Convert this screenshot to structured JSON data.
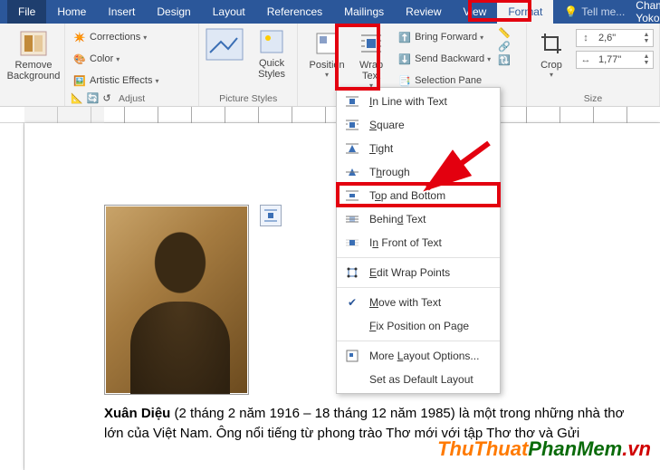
{
  "menubar": {
    "file": "File",
    "tabs": [
      "Home",
      "Insert",
      "Design",
      "Layout",
      "References",
      "Mailings",
      "Review",
      "View",
      "Format"
    ],
    "active": "Format",
    "tellme": "Tell me...",
    "user": "Cham Yoko"
  },
  "ribbon": {
    "adjust": {
      "remove_bg": "Remove\nBackground",
      "corrections": "Corrections",
      "color": "Color",
      "artistic": "Artistic Effects",
      "label": "Adjust"
    },
    "styles": {
      "quick": "Quick\nStyles",
      "label": "Picture Styles"
    },
    "arrange": {
      "position": "Position",
      "wrap": "Wrap\nText",
      "forward": "Bring Forward",
      "backward": "Send Backward",
      "selection": "Selection Pane"
    },
    "size": {
      "crop": "Crop",
      "height": "2,6\"",
      "width": "1,77\"",
      "label": "Size"
    }
  },
  "wrap_menu": {
    "inline": "In Line with Text",
    "square": "Square",
    "tight": "Tight",
    "through": "Through",
    "topbottom": "Top and Bottom",
    "behind": "Behind Text",
    "infront": "In Front of Text",
    "editpoints": "Edit Wrap Points",
    "movewith": "Move with Text",
    "fixpos": "Fix Position on Page",
    "more": "More Layout Options...",
    "default": "Set as Default Layout"
  },
  "doc": {
    "bold": "Xuân Diệu",
    "para": " (2 tháng 2 năm 1916 – 18 tháng 12 năm 1985) là một trong những nhà thơ lớn của Việt Nam. Ông nổi tiếng từ phong trào Thơ mới với tập Thơ thơ và Gửi"
  },
  "watermark": {
    "a": "ThuThuat",
    "b": "PhanMem",
    "c": ".vn"
  }
}
